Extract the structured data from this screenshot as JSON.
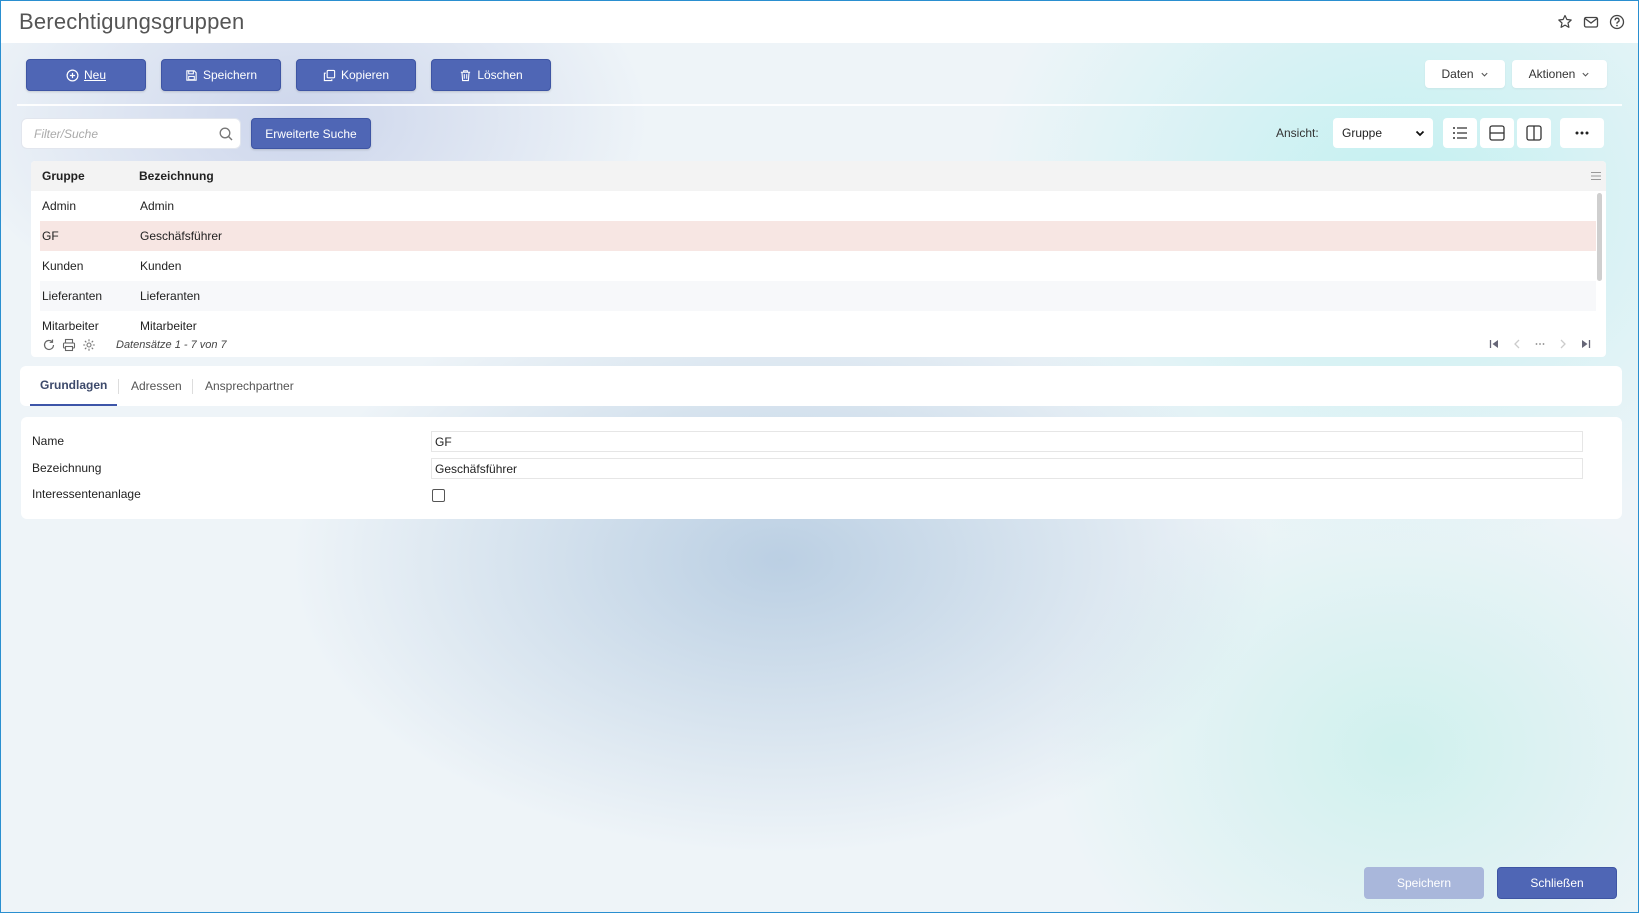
{
  "window": {
    "title": "Berechtigungsgruppen"
  },
  "header_icons": [
    "star-icon",
    "mail-icon",
    "help-icon"
  ],
  "toolbar": {
    "new_label": "Neu",
    "save_label": "Speichern",
    "copy_label": "Kopieren",
    "delete_label": "Löschen",
    "data_menu_label": "Daten",
    "actions_menu_label": "Aktionen"
  },
  "search": {
    "placeholder": "Filter/Suche",
    "advanced_label": "Erweiterte Suche"
  },
  "view": {
    "label": "Ansicht:",
    "selected": "Gruppe"
  },
  "grid": {
    "columns": [
      "Gruppe",
      "Bezeichnung"
    ],
    "rows": [
      {
        "gruppe": "Admin",
        "bezeichnung": "Admin"
      },
      {
        "gruppe": "GF",
        "bezeichnung": "Geschäfsführer",
        "selected": true
      },
      {
        "gruppe": "Kunden",
        "bezeichnung": "Kunden"
      },
      {
        "gruppe": "Lieferanten",
        "bezeichnung": "Lieferanten"
      },
      {
        "gruppe": "Mitarbeiter",
        "bezeichnung": "Mitarbeiter"
      }
    ],
    "record_info": "Datensätze 1 - 7 von 7"
  },
  "tabs": [
    "Grundlagen",
    "Adressen",
    "Ansprechpartner"
  ],
  "active_tab": "Grundlagen",
  "form": {
    "name_label": "Name",
    "name_value": "GF",
    "bezeichnung_label": "Bezeichnung",
    "bezeichnung_value": "Geschäfsführer",
    "interessent_label": "Interessentenanlage",
    "interessent_checked": false
  },
  "footer": {
    "save_label": "Speichern",
    "close_label": "Schließen"
  },
  "colors": {
    "primary": "#4f66b5",
    "selected_row": "#f7e6e3",
    "disabled_button": "#a9b7db"
  }
}
